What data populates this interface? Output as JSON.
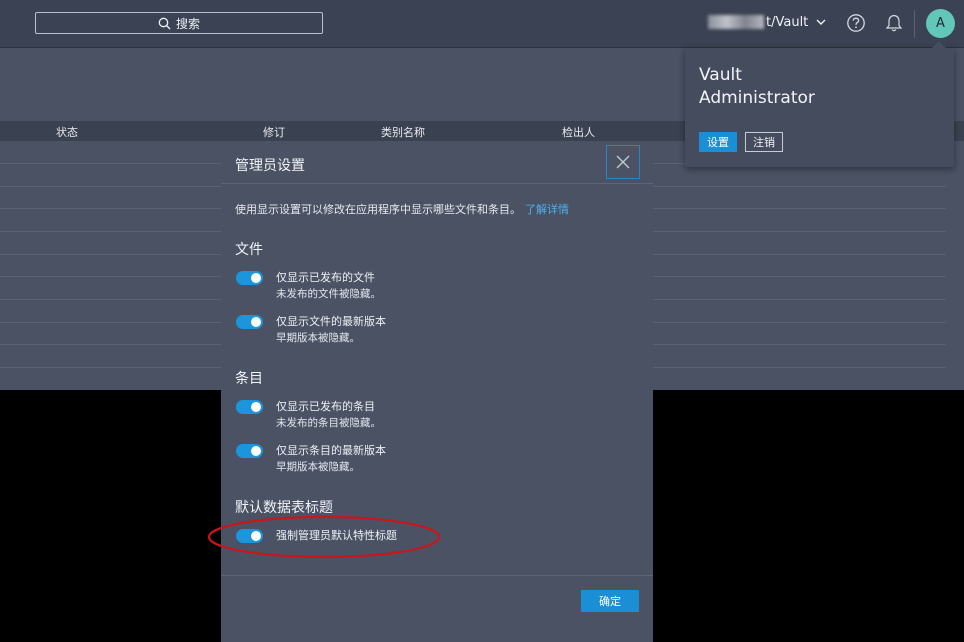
{
  "topbar": {
    "search_label": "搜索",
    "server_label": "t/Vault",
    "avatar_initial": "A"
  },
  "user_menu": {
    "name_line1": "Vault",
    "name_line2": "Administrator",
    "settings_label": "设置",
    "logout_label": "注销"
  },
  "table": {
    "columns": [
      "状态",
      "修订",
      "类别名称",
      "检出人"
    ]
  },
  "modal": {
    "title": "管理员设置",
    "intro": "使用显示设置可以修改在应用程序中显示哪些文件和条目。",
    "learn_more": "了解详情",
    "sections": [
      {
        "title": "文件",
        "toggles": [
          {
            "label": "仅显示已发布的文件",
            "desc": "未发布的文件被隐藏。",
            "on": true
          },
          {
            "label": "仅显示文件的最新版本",
            "desc": "早期版本被隐藏。",
            "on": true
          }
        ]
      },
      {
        "title": "条目",
        "toggles": [
          {
            "label": "仅显示已发布的条目",
            "desc": "未发布的条目被隐藏。",
            "on": true
          },
          {
            "label": "仅显示条目的最新版本",
            "desc": "早期版本被隐藏。",
            "on": true
          }
        ]
      },
      {
        "title": "默认数据表标题",
        "toggles": [
          {
            "label": "强制管理员默认特性标题",
            "on": true
          }
        ]
      }
    ],
    "ok_label": "确定"
  },
  "colors": {
    "accent": "#1a8fd6",
    "annotation": "#c8161d",
    "avatar": "#62c6b8",
    "panel": "#4a5264",
    "topbar": "#3b4253"
  }
}
